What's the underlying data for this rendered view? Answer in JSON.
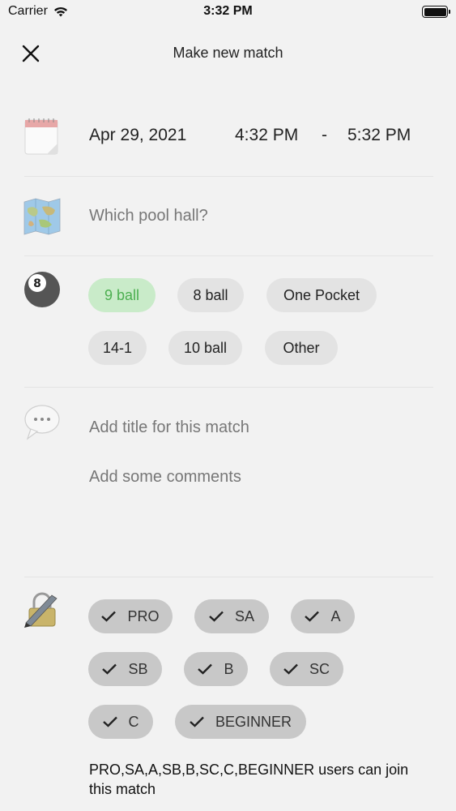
{
  "status_bar": {
    "carrier": "Carrier",
    "time": "3:32 PM"
  },
  "nav": {
    "title": "Make new match"
  },
  "schedule": {
    "date": "Apr 29, 2021",
    "start_time": "4:32 PM",
    "separator": "-",
    "end_time": "5:32 PM"
  },
  "location": {
    "placeholder": "Which pool hall?"
  },
  "game_types": {
    "options": [
      "9 ball",
      "8 ball",
      "One Pocket",
      "14-1",
      "10 ball",
      "Other"
    ],
    "selected": "9 ball",
    "selected_color": "#4caf50"
  },
  "details": {
    "title_placeholder": "Add title for this match",
    "comments_placeholder": "Add some comments"
  },
  "levels": {
    "options": [
      "PRO",
      "SA",
      "A",
      "SB",
      "B",
      "SC",
      "C",
      "BEGINNER"
    ],
    "summary": "PRO,SA,A,SB,B,SC,C,BEGINNER users can join this match"
  },
  "icons": {
    "close": "close-icon",
    "calendar": "calendar-icon",
    "map": "map-icon",
    "eight_ball": "eight-ball-icon",
    "chat": "chat-bubble-icon",
    "lock_pen": "lock-pen-icon"
  }
}
